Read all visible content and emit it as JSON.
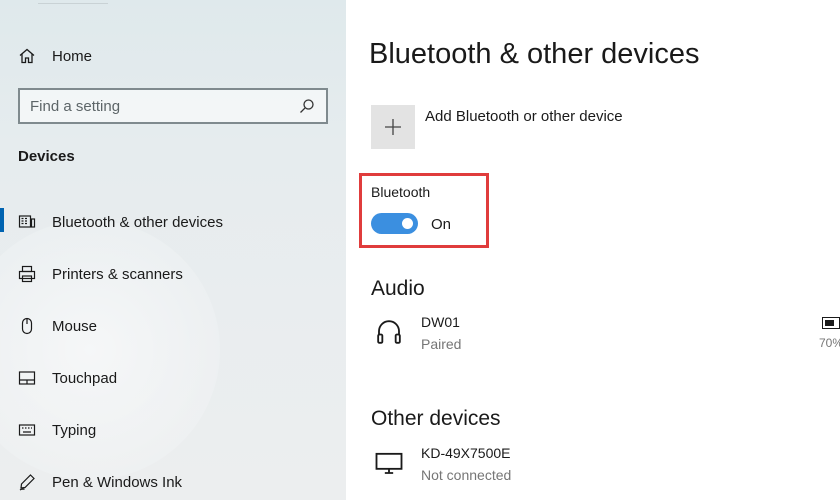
{
  "sidebar": {
    "home_label": "Home",
    "search_placeholder": "Find a setting",
    "section_title": "Devices",
    "items": [
      {
        "label": "Bluetooth & other devices",
        "icon": "bluetooth-devices-icon",
        "active": true
      },
      {
        "label": "Printers & scanners",
        "icon": "printer-icon"
      },
      {
        "label": "Mouse",
        "icon": "mouse-icon"
      },
      {
        "label": "Touchpad",
        "icon": "touchpad-icon"
      },
      {
        "label": "Typing",
        "icon": "keyboard-icon"
      },
      {
        "label": "Pen & Windows Ink",
        "icon": "pen-icon"
      }
    ]
  },
  "main": {
    "title": "Bluetooth & other devices",
    "add_device_label": "Add Bluetooth or other device",
    "bluetooth": {
      "label": "Bluetooth",
      "state": "On",
      "enabled": true
    },
    "audio": {
      "heading": "Audio",
      "devices": [
        {
          "name": "DW01",
          "status": "Paired",
          "icon": "headphones-icon",
          "battery": "70%"
        }
      ]
    },
    "other": {
      "heading": "Other devices",
      "devices": [
        {
          "name": "KD-49X7500E",
          "status": "Not connected",
          "icon": "monitor-icon"
        }
      ]
    }
  },
  "colors": {
    "accent": "#0063b1",
    "toggle_on": "#3b8fe0",
    "highlight_box": "#e03c3c"
  }
}
